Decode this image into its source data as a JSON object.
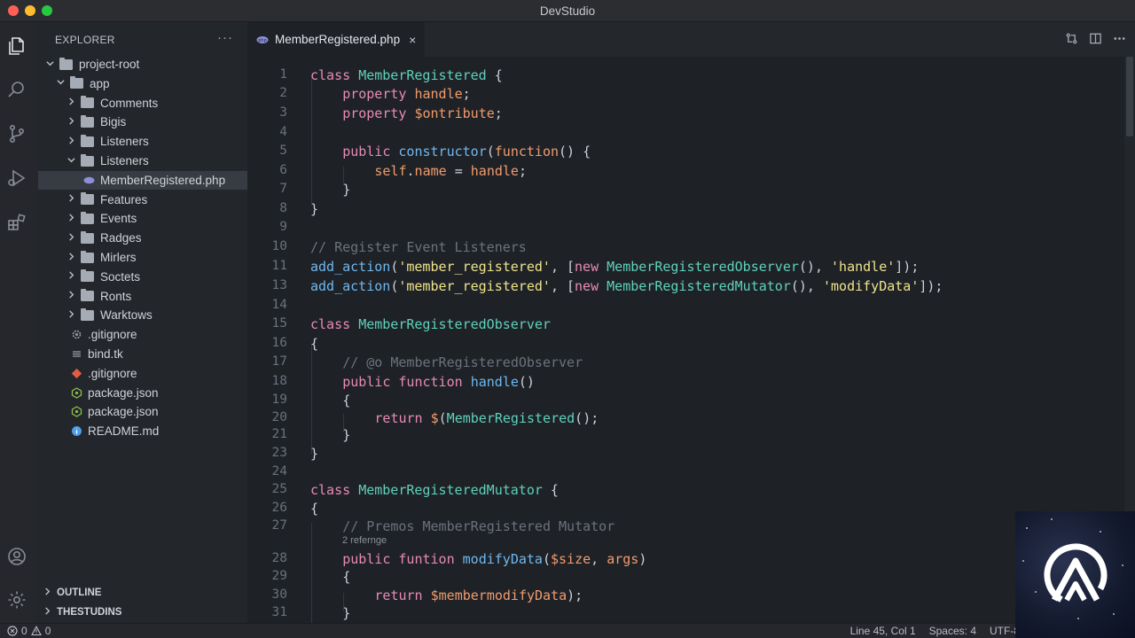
{
  "window": {
    "title": "DevStudio"
  },
  "activity": [
    "explorer-icon",
    "search-icon",
    "source-control-icon",
    "run-debug-icon",
    "extensions-icon",
    "account-icon",
    "settings-icon"
  ],
  "sidebar": {
    "header": "EXPLORER",
    "more": "···",
    "tree": [
      {
        "label": "project-root",
        "kind": "folder",
        "depth": 0,
        "open": true
      },
      {
        "label": "app",
        "kind": "folder",
        "depth": 1,
        "open": true
      },
      {
        "label": "Comments",
        "kind": "folder",
        "depth": 2,
        "open": false
      },
      {
        "label": "Bigis",
        "kind": "folder",
        "depth": 2,
        "open": false
      },
      {
        "label": "Listeners",
        "kind": "folder",
        "depth": 2,
        "open": false
      },
      {
        "label": "Listeners",
        "kind": "folder",
        "depth": 2,
        "open": true
      },
      {
        "label": "MemberRegistered.php",
        "kind": "php",
        "depth": 3,
        "selected": true
      },
      {
        "label": "Features",
        "kind": "folder",
        "depth": 2,
        "open": false
      },
      {
        "label": "Events",
        "kind": "folder",
        "depth": 2,
        "open": false
      },
      {
        "label": "Radges",
        "kind": "folder",
        "depth": 2,
        "open": false
      },
      {
        "label": "Mirlers",
        "kind": "folder",
        "depth": 2,
        "open": false
      },
      {
        "label": "Soctets",
        "kind": "folder",
        "depth": 2,
        "open": false
      },
      {
        "label": "Ronts",
        "kind": "folder",
        "depth": 2,
        "open": false
      },
      {
        "label": "Warktows",
        "kind": "folder",
        "depth": 2,
        "open": false
      },
      {
        "label": ".gitignore",
        "kind": "gear",
        "depth": 1
      },
      {
        "label": "bind.tk",
        "kind": "lines",
        "depth": 1
      },
      {
        "label": ".gitignore",
        "kind": "git",
        "depth": 1
      },
      {
        "label": "package.json",
        "kind": "node",
        "depth": 1
      },
      {
        "label": "package.json",
        "kind": "node",
        "depth": 1
      },
      {
        "label": "README.md",
        "kind": "info",
        "depth": 1
      }
    ],
    "sections": [
      "OUTLINE",
      "THESTUDINS"
    ]
  },
  "editor": {
    "tab": {
      "label": "MemberRegistered.php",
      "close": "×"
    },
    "lines": [
      {
        "n": "1",
        "indent": 0,
        "tokens": [
          [
            "kw",
            "class "
          ],
          [
            "cls",
            "MemberRegistered"
          ],
          [
            "pl",
            " {"
          ]
        ]
      },
      {
        "n": "2",
        "indent": 1,
        "tokens": [
          [
            "kw",
            "property "
          ],
          [
            "prop",
            "handle"
          ],
          [
            "pl",
            ";"
          ]
        ]
      },
      {
        "n": "3",
        "indent": 1,
        "tokens": [
          [
            "kw",
            "property "
          ],
          [
            "var",
            "$ontribute"
          ],
          [
            "pl",
            ";"
          ]
        ]
      },
      {
        "n": "4",
        "indent": 0,
        "tokens": []
      },
      {
        "n": "5",
        "indent": 1,
        "tokens": [
          [
            "kw",
            "public "
          ],
          [
            "fn",
            "constructor"
          ],
          [
            "pl",
            "("
          ],
          [
            "var",
            "function"
          ],
          [
            "pl",
            "() {"
          ]
        ]
      },
      {
        "n": "6",
        "indent": 2,
        "tokens": [
          [
            "var",
            "self"
          ],
          [
            "pl",
            "."
          ],
          [
            "prop",
            "name"
          ],
          [
            "pl",
            " = "
          ],
          [
            "var",
            "handle"
          ],
          [
            "pl",
            ";"
          ]
        ]
      },
      {
        "n": "7",
        "indent": 1,
        "tokens": [
          [
            "pl",
            "}"
          ]
        ]
      },
      {
        "n": "8",
        "indent": 0,
        "tokens": [
          [
            "pl",
            "}"
          ]
        ]
      },
      {
        "n": "9",
        "indent": 0,
        "tokens": []
      },
      {
        "n": "10",
        "indent": 0,
        "tokens": [
          [
            "com",
            "// Register Event Listeners"
          ]
        ]
      },
      {
        "n": "11",
        "indent": 0,
        "tokens": [
          [
            "fn",
            "add_action"
          ],
          [
            "pl",
            "("
          ],
          [
            "str",
            "'member_registered'"
          ],
          [
            "pl",
            ", ["
          ],
          [
            "kw",
            "new "
          ],
          [
            "cls",
            "MemberRegisteredObserver"
          ],
          [
            "pl",
            "(), "
          ],
          [
            "str",
            "'handle'"
          ],
          [
            "pl",
            "]);"
          ]
        ]
      },
      {
        "n": "13",
        "indent": 0,
        "tokens": [
          [
            "fn",
            "add_action"
          ],
          [
            "pl",
            "("
          ],
          [
            "str",
            "'member_registered'"
          ],
          [
            "pl",
            ", ["
          ],
          [
            "kw",
            "new "
          ],
          [
            "cls",
            "MemberRegisteredMutator"
          ],
          [
            "pl",
            "(), "
          ],
          [
            "str",
            "'modifyData'"
          ],
          [
            "pl",
            "]);"
          ]
        ]
      },
      {
        "n": "14",
        "indent": 0,
        "tokens": []
      },
      {
        "n": "15",
        "indent": 0,
        "tokens": [
          [
            "kw",
            "class "
          ],
          [
            "cls",
            "MemberRegisteredObserver"
          ]
        ]
      },
      {
        "n": "16",
        "indent": 0,
        "tokens": [
          [
            "pl",
            "{"
          ]
        ]
      },
      {
        "n": "17",
        "indent": 1,
        "tokens": [
          [
            "com",
            "// @o MemberRegisteredObserver"
          ]
        ]
      },
      {
        "n": "18",
        "indent": 1,
        "tokens": [
          [
            "kw",
            "public function "
          ],
          [
            "fn",
            "handle"
          ],
          [
            "pl",
            "()"
          ]
        ]
      },
      {
        "n": "19",
        "indent": 1,
        "tokens": [
          [
            "pl",
            "{"
          ]
        ]
      },
      {
        "n": "20",
        "indent": 2,
        "tokens": [
          [
            "kw",
            "return "
          ],
          [
            "var",
            "$"
          ],
          [
            "pl",
            "("
          ],
          [
            "cls",
            "MemberRegistered"
          ],
          [
            "pl",
            "();"
          ]
        ]
      },
      {
        "n": "21",
        "indent": 1,
        "tokens": [
          [
            "pl",
            "}"
          ]
        ]
      },
      {
        "n": "23",
        "indent": 0,
        "tokens": [
          [
            "pl",
            "}"
          ]
        ]
      },
      {
        "n": "24",
        "indent": 0,
        "tokens": []
      },
      {
        "n": "25",
        "indent": 0,
        "tokens": [
          [
            "kw",
            "class "
          ],
          [
            "cls",
            "MemberRegisteredMutator"
          ],
          [
            "pl",
            " {"
          ]
        ]
      },
      {
        "n": "26",
        "indent": 0,
        "tokens": [
          [
            "pl",
            "{"
          ]
        ]
      },
      {
        "n": "27",
        "indent": 1,
        "tokens": [
          [
            "com",
            "// Premos MemberRegistered Mutator"
          ]
        ]
      },
      {
        "n": "",
        "lens": "2 refernge"
      },
      {
        "n": "28",
        "indent": 1,
        "tokens": [
          [
            "kw",
            "public funtion "
          ],
          [
            "fn",
            "modifyData"
          ],
          [
            "pl",
            "("
          ],
          [
            "var",
            "$size"
          ],
          [
            "pl",
            ", "
          ],
          [
            "var",
            "args"
          ],
          [
            "pl",
            ")"
          ]
        ]
      },
      {
        "n": "29",
        "indent": 1,
        "tokens": [
          [
            "pl",
            "{"
          ]
        ]
      },
      {
        "n": "30",
        "indent": 2,
        "tokens": [
          [
            "kw",
            "return "
          ],
          [
            "var",
            "$membermodifyData"
          ],
          [
            "pl",
            ");"
          ]
        ]
      },
      {
        "n": "31",
        "indent": 1,
        "tokens": [
          [
            "pl",
            "}"
          ]
        ]
      },
      {
        "n": "",
        "indent": 0,
        "tokens": [
          [
            "pl",
            "}"
          ]
        ]
      }
    ]
  },
  "status": {
    "errors": "0",
    "warnings": "0",
    "position": "Line 45, Col 1",
    "spaces": "Spaces: 4",
    "encoding": "UTF-8"
  },
  "colors": {
    "accent": "#5fd1ba",
    "keyword": "#e88bb3",
    "string": "#f0e48b",
    "function": "#6fb8f0"
  }
}
